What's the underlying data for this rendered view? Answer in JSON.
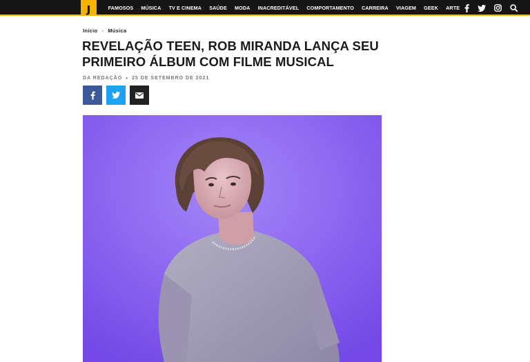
{
  "nav": {
    "items": [
      "FAMOSOS",
      "MÚSICA",
      "TV E CINEMA",
      "SAÚDE",
      "MODA",
      "INACREDITÁVEL",
      "COMPORTAMENTO",
      "CARREIRA",
      "VIAGEM",
      "GEEK",
      "ARTE"
    ]
  },
  "breadcrumb": {
    "home": "Início",
    "separator": "›",
    "category": "Música"
  },
  "article": {
    "title_line1": "REVELAÇÃO TEEN, ROB MIRANDA LANÇA SEU",
    "title_line2": "PRIMEIRO ÁLBUM COM FILME MUSICAL",
    "author": "DA REDAÇÃO",
    "bullet": "•",
    "date": "25 DE SETEMBRO DE 2021"
  },
  "icons": {
    "top": [
      "facebook-icon",
      "twitter-icon",
      "instagram-icon",
      "search-icon"
    ],
    "share": [
      "facebook-icon",
      "twitter-icon",
      "email-icon"
    ]
  },
  "colors": {
    "accent": "#f5b400",
    "topbar": "#151515",
    "facebook": "#3b5998",
    "twitter": "#1da1f2",
    "email": "#222222",
    "hero_background": "#8a63f0"
  }
}
